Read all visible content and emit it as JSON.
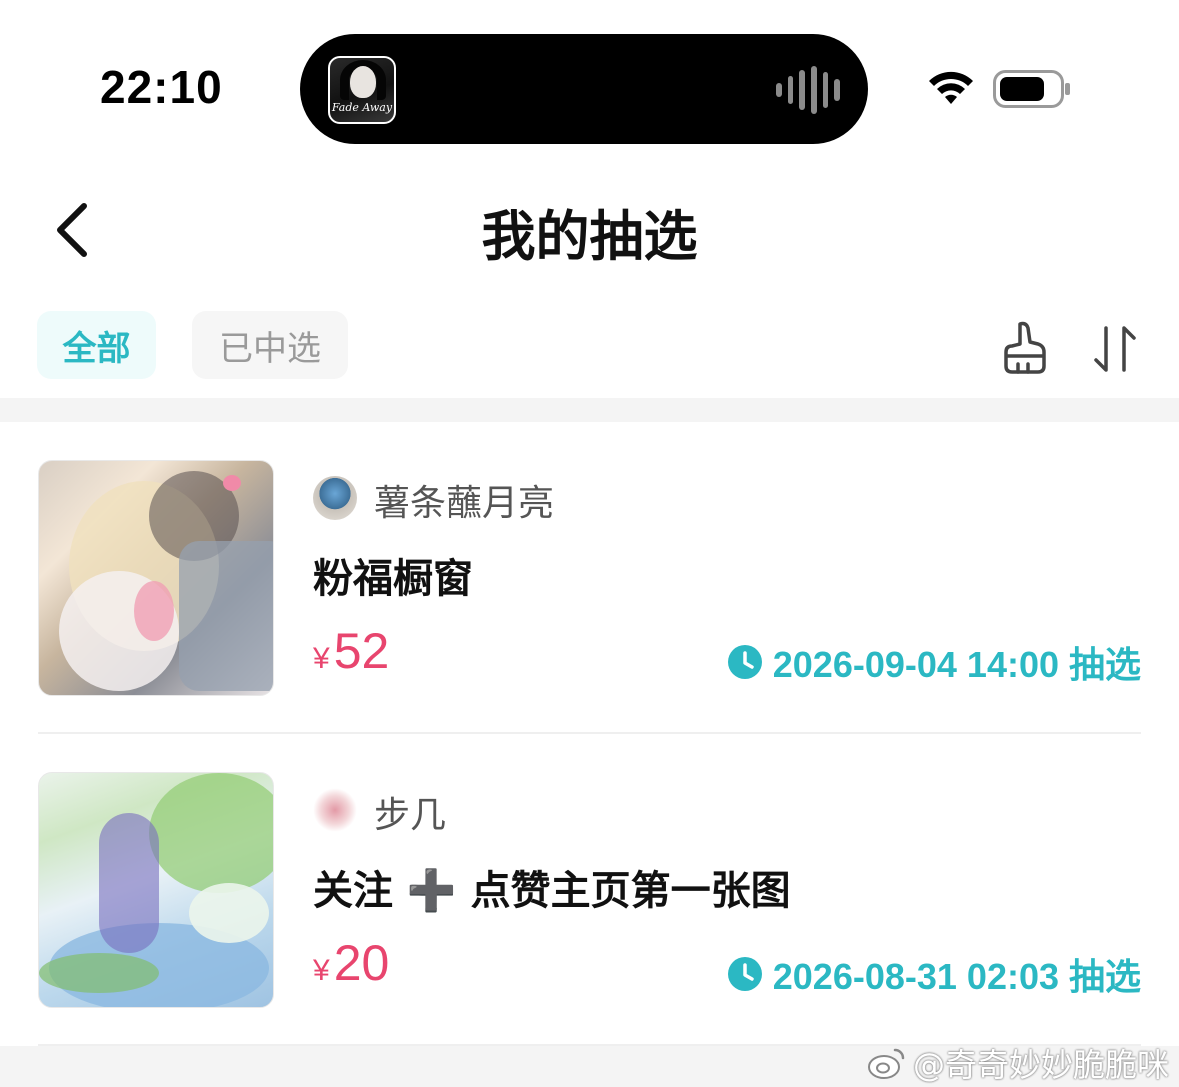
{
  "status_bar": {
    "time": "22:10",
    "now_playing_art_text": "Fade Away"
  },
  "nav": {
    "title": "我的抽选"
  },
  "filters": {
    "tabs": [
      {
        "label": "全部",
        "active": true
      },
      {
        "label": "已中选",
        "active": false
      }
    ]
  },
  "items": [
    {
      "author": "薯条蘸月亮",
      "title": "粉福橱窗",
      "currency": "¥",
      "price": "52",
      "draw_time": "2026-09-04 14:00 抽选"
    },
    {
      "author": "步几",
      "title": "关注 ➕ 点赞主页第一张图",
      "currency": "¥",
      "price": "20",
      "draw_time": "2026-08-31 02:03 抽选"
    }
  ],
  "watermark": "@奇奇妙妙脆脆咪",
  "colors": {
    "accent": "#2bb8c3",
    "price": "#e8456e",
    "active_chip_bg": "#eefbfb"
  },
  "icons": [
    "back-chevron-icon",
    "brush-icon",
    "sort-icon",
    "clock-icon",
    "wifi-icon",
    "battery-icon",
    "waveform-icon"
  ]
}
